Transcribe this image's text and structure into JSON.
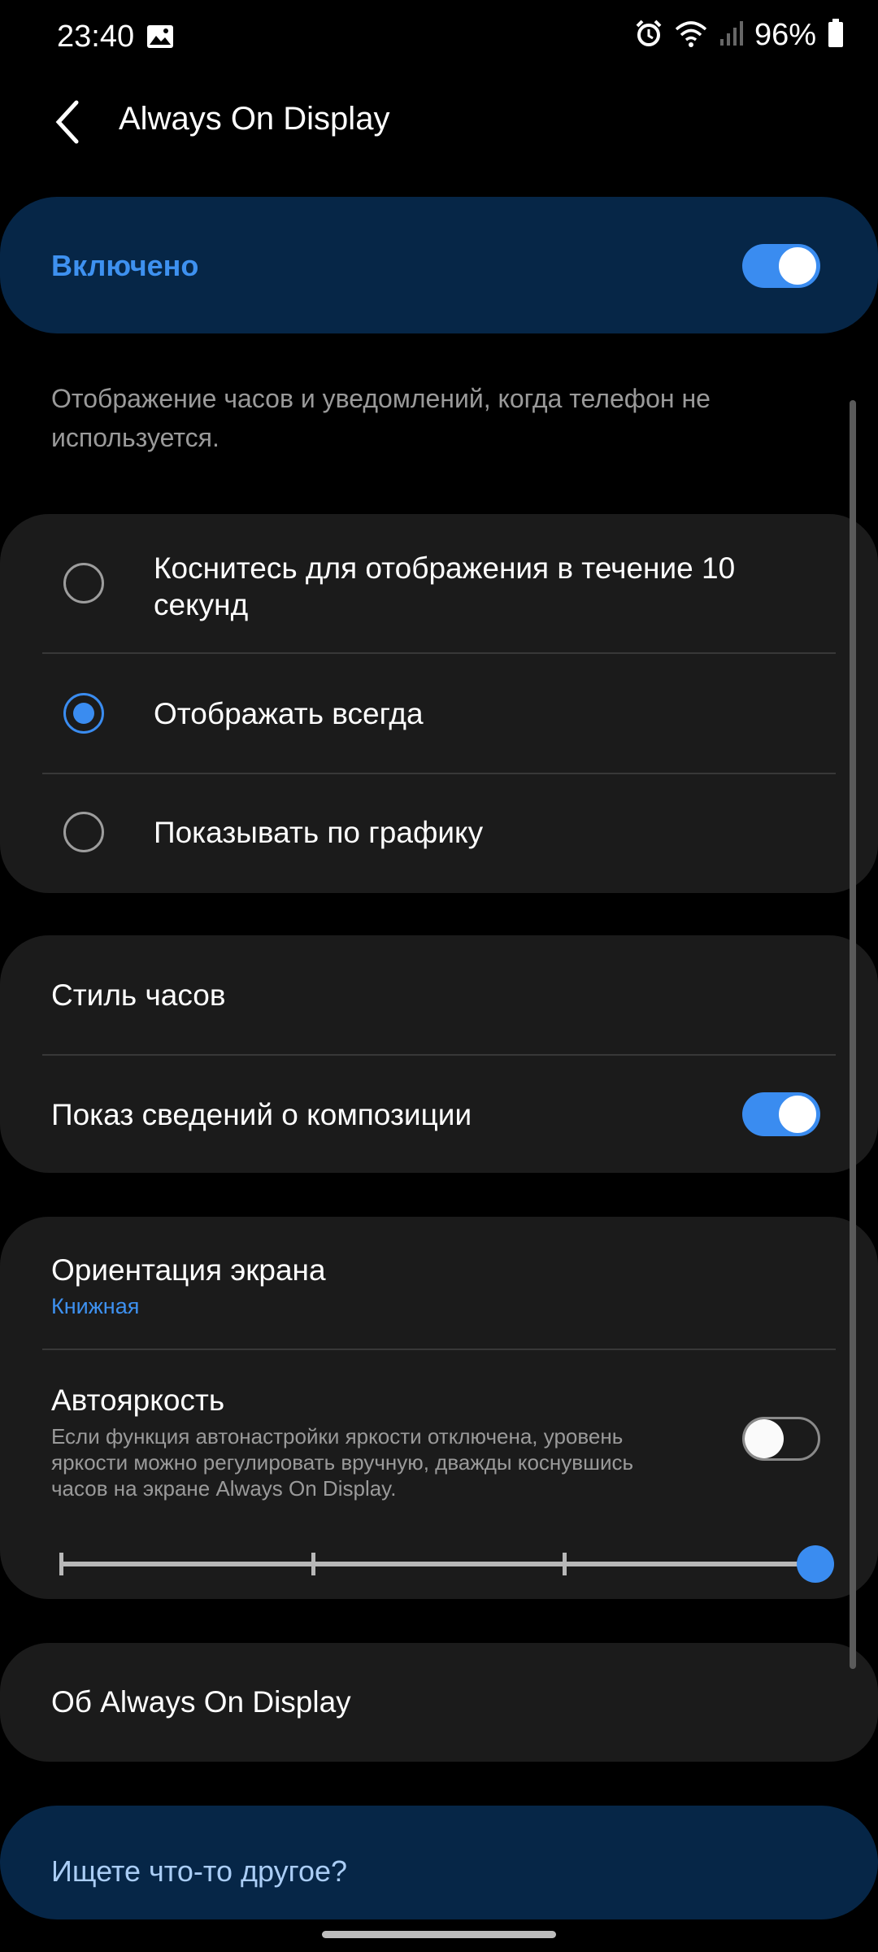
{
  "status_bar": {
    "time": "23:40",
    "battery": "96%",
    "icons": [
      "image-icon",
      "alarm-icon",
      "wifi-icon",
      "signal-icon",
      "battery-icon"
    ]
  },
  "header": {
    "title": "Always On Display",
    "back_icon": "chevron-left-icon"
  },
  "master": {
    "label": "Включено",
    "enabled": true
  },
  "description": "Отображение часов и уведомлений, когда телефон не используется.",
  "display_mode": {
    "options": [
      {
        "label": "Коснитесь для отображения в течение 10 секунд",
        "selected": false
      },
      {
        "label": "Отображать всегда",
        "selected": true
      },
      {
        "label": "Показывать по графику",
        "selected": false
      }
    ]
  },
  "clock_group": {
    "clock_style": "Стиль часов",
    "music_info": "Показ сведений о композиции",
    "music_info_enabled": true
  },
  "screen_group": {
    "orientation_title": "Ориентация экрана",
    "orientation_value": "Книжная",
    "auto_brightness_title": "Автояркость",
    "auto_brightness_desc": "Если функция автонастройки яркости отключена, уровень яркости можно регулировать вручную, дважды коснувшись часов на экране Always On Display.",
    "auto_brightness_enabled": false,
    "brightness_level": 1.0
  },
  "about": "Об Always On Display",
  "search": "Ищете что-то другое?",
  "colors": {
    "accent": "#3a8cf0",
    "card": "#1b1b1b",
    "highlight_card": "#062647"
  }
}
